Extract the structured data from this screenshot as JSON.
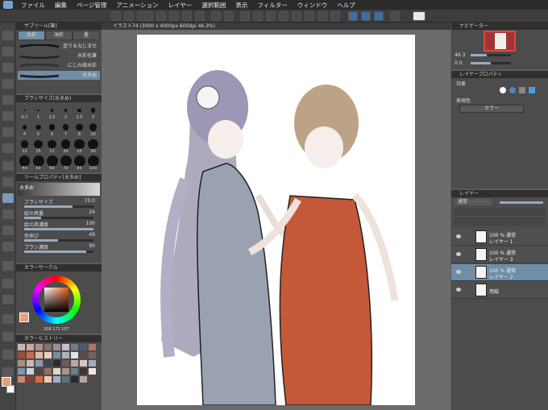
{
  "menu": {
    "items": [
      "ファイル",
      "編集",
      "ページ管理",
      "アニメーション",
      "レイヤー",
      "選択範囲",
      "表示",
      "フィルター",
      "ウィンドウ",
      "ヘルプ"
    ]
  },
  "document": {
    "tab_title": "イラスト74 (3000 x 4000px 600dpi 46.3%)"
  },
  "subtool_panel": {
    "title": "サブツール[筆]",
    "tabs": [
      "水彩",
      "油彩",
      "墨"
    ],
    "brushes": [
      "塗り＆なじませ",
      "水彩毛筆",
      "にじみ縁水彩",
      "水多め"
    ]
  },
  "brush_size_panel": {
    "title": "ブラシサイズ(水多め)",
    "sizes": [
      "0.7",
      "1",
      "1.5",
      "2",
      "2.5",
      "3",
      "4",
      "5",
      "6",
      "7",
      "8",
      "10",
      "12",
      "15",
      "17",
      "20",
      "25",
      "30",
      "40",
      "50",
      "60",
      "70",
      "80",
      "100"
    ]
  },
  "tool_property": {
    "title": "ツールプロパティ[水多め]",
    "name": "水多め",
    "props": [
      {
        "label": "ブラシサイズ",
        "value": "70.0",
        "fill": 0.7
      },
      {
        "label": "絵の具量",
        "value": "24",
        "fill": 0.24
      },
      {
        "label": "絵の具濃度",
        "value": "100",
        "fill": 1.0
      },
      {
        "label": "色伸び",
        "value": "49",
        "fill": 0.49
      },
      {
        "label": "ブラシ濃度",
        "value": "90",
        "fill": 0.9
      }
    ]
  },
  "color_wheel": {
    "title": "カラーサークル",
    "hsv": [
      "208",
      "171",
      "157"
    ],
    "main_color": "#e6a07a"
  },
  "color_history": {
    "title": "カラーヒストリー",
    "swatches": [
      "#c9b6b0",
      "#d7a497",
      "#b28f86",
      "#8c6d6b",
      "#9c8e94",
      "#c4c0c8",
      "#6f7a8c",
      "#4f5a6c",
      "#b1746a",
      "#9a4e3e",
      "#c76a50",
      "#e3b7a3",
      "#ecd0c0",
      "#7a8b9b",
      "#aab4c0",
      "#dfe3e8",
      "#5b4b4a",
      "#75625e",
      "#a48f86",
      "#c7b9b0",
      "#8e9aa8",
      "#3b4654",
      "#2c2c2c",
      "#6c5b57",
      "#b8a89f",
      "#d9c9bd",
      "#9db0c0",
      "#7e95a6",
      "#c9d3dc",
      "#514544",
      "#8f7064",
      "#e1d6cb",
      "#a7928a",
      "#6c7c8c",
      "#3d3132",
      "#efe6dc",
      "#c68b74",
      "#8c3c2c",
      "#d56a4e",
      "#f2c7b0",
      "#9fb2c6",
      "#5f707e",
      "#272a30",
      "#b4a6a0"
    ]
  },
  "navigator": {
    "title": "ナビゲーター",
    "zoom": "46.3",
    "angle": "0.0"
  },
  "layer_property": {
    "title": "レイヤープロパティ",
    "effect_label": "効果",
    "expr_label": "表現色",
    "expr_value": "カラー"
  },
  "layers": {
    "title": "レイヤー",
    "blend": "通常",
    "items": [
      {
        "mode": "100 % 通常",
        "name": "レイヤー 1",
        "selected": false
      },
      {
        "mode": "100 % 通常",
        "name": "レイヤー 3",
        "selected": false
      },
      {
        "mode": "100 % 通常",
        "name": "レイヤー 2",
        "selected": true
      },
      {
        "mode": "",
        "name": "用紙",
        "selected": false
      }
    ]
  }
}
